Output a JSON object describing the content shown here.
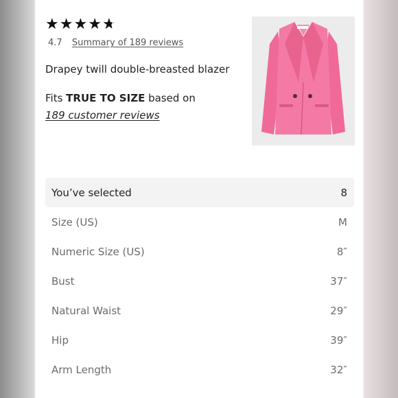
{
  "stars": {
    "count": 5,
    "filled": 4.7,
    "icon": "star-icon"
  },
  "rating": {
    "value": "4.7",
    "summary_link": "Summary of 189 reviews"
  },
  "product": {
    "name": "Drapey twill double-breasted blazer",
    "image_color": "#f26f9e"
  },
  "fit": {
    "prefix": "Fits ",
    "emphasis": "TRUE TO SIZE",
    "suffix": " based on",
    "reviews_link": "189 customer reviews"
  },
  "size_table": {
    "rows": [
      {
        "label": "You’ve selected",
        "value": "8"
      },
      {
        "label": "Size (US)",
        "value": "M"
      },
      {
        "label": "Numeric Size (US)",
        "value": "8″"
      },
      {
        "label": "Bust",
        "value": "37″"
      },
      {
        "label": "Natural Waist",
        "value": "29″"
      },
      {
        "label": "Hip",
        "value": "39″"
      },
      {
        "label": "Arm Length",
        "value": "32″"
      }
    ]
  }
}
